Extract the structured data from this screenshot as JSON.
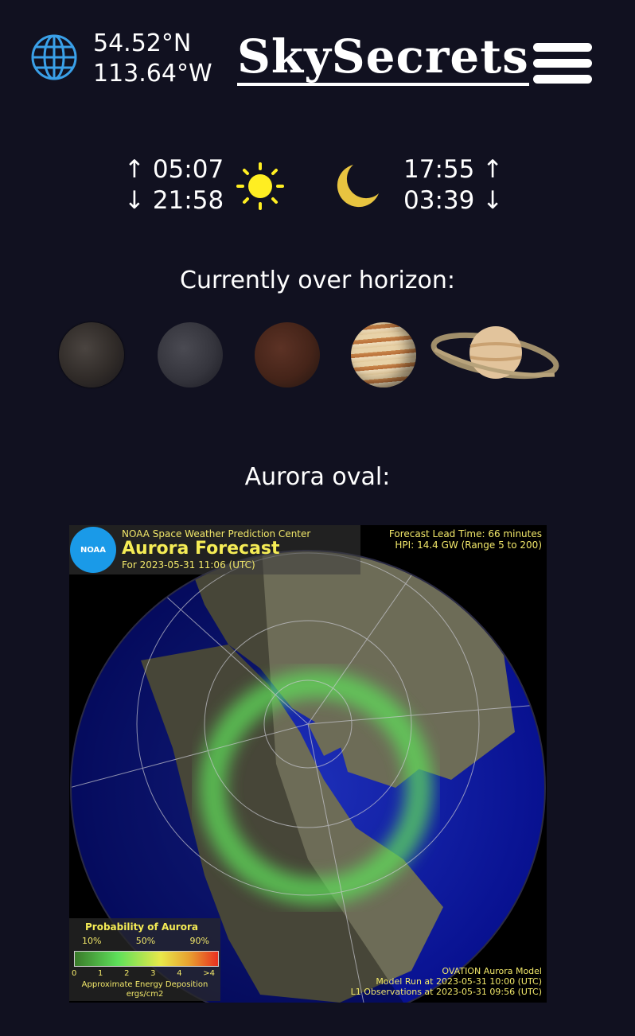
{
  "header": {
    "latitude": "54.52°N",
    "longitude": "113.64°W",
    "brand": "SkySecrets",
    "globe_icon": "globe-icon",
    "menu_icon": "hamburger-menu-icon"
  },
  "sun": {
    "rise": "↑ 05:07",
    "set": "↓ 21:58",
    "icon": "sun-icon",
    "color": "#ffee22"
  },
  "moon": {
    "rise": "17:55 ↑",
    "set": "03:39 ↓",
    "icon": "crescent-moon-icon",
    "color": "#e8c440"
  },
  "horizon": {
    "heading": "Currently over horizon:",
    "planets": [
      "mercury-icon",
      "venus-icon",
      "mars-icon",
      "jupiter-icon",
      "saturn-icon"
    ]
  },
  "aurora": {
    "heading": "Aurora oval:",
    "org": "NOAA Space Weather Prediction Center",
    "logo_text": "NOAA",
    "title": "Aurora Forecast",
    "for_date": "For 2023-05-31 11:06 (UTC)",
    "lead_time": "Forecast Lead Time:  66 minutes",
    "hpi": "HPI:  14.4 GW (Range 5 to 200)",
    "legend": {
      "title": "Probability of Aurora",
      "pct": [
        "10%",
        "50%",
        "90%"
      ],
      "scale": [
        "0",
        "1",
        "2",
        "3",
        "4",
        ">4"
      ],
      "caption1": "Approximate Energy Deposition",
      "caption2": "ergs/cm2"
    },
    "model": "OVATION Aurora Model",
    "model_run": "Model Run at 2023-05-31 10:00 (UTC)",
    "l1_obs": "L1 Observations at 2023-05-31 09:56 (UTC)",
    "colors": {
      "ocean": "#0a1aa8",
      "land": "#6e6d5a",
      "aurora": "#5ee05a",
      "text": "#f2e86a"
    }
  }
}
